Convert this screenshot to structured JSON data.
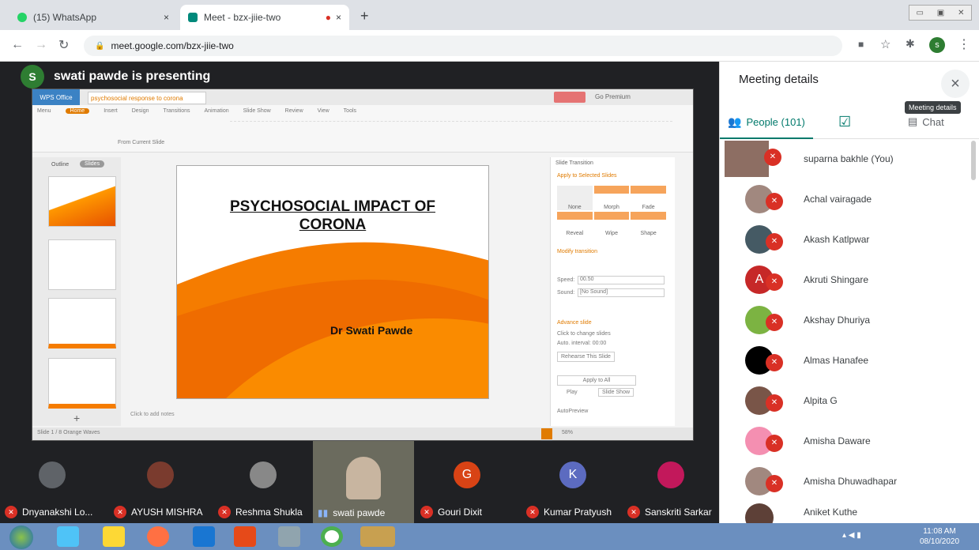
{
  "browser": {
    "tabs": [
      {
        "label": "(15) WhatsApp",
        "close": "×"
      },
      {
        "label": "Meet - bzx-jiie-two",
        "close": "×"
      }
    ],
    "new_tab": "+",
    "url": "meet.google.com/bzx-jiie-two",
    "profile_initial": "s"
  },
  "meet": {
    "presenter_initial": "S",
    "presenting_text": "swati pawde is presenting"
  },
  "slide": {
    "title_line1": "PSYCHOSOCIAL IMPACT OF",
    "title_line2": "CORONA",
    "author": "Dr Swati Pawde"
  },
  "app": {
    "left_tab": "Outline",
    "right_tab": "Slides",
    "panel_title": "Slide Transition",
    "panel_sub": "Apply to Selected Slides",
    "transitions": [
      "None",
      "Morph",
      "Fade",
      "Reveal",
      "Wipe",
      "Shape"
    ],
    "modify": "Modify transition",
    "speed_label": "Speed:",
    "speed_value": "00.50",
    "sound_label": "Sound:",
    "sound_value": "[No Sound]",
    "advance": "Advance slide",
    "on_click": "Click to change slides",
    "auto": "Auto. interval: 00:00",
    "rehearse": "Rehearse This Slide",
    "apply_all": "Apply to All",
    "play": "Play",
    "slide_show": "Slide Show",
    "autopreview": "AutoPreview",
    "notes": "Click to add notes",
    "status": "Slide 1 / 8   Orange Waves",
    "zoom": "58%",
    "present_btn": "Go Premium",
    "wps": "WPS Office",
    "doc_tab": "psychosocial response to corona",
    "from_current": "From Current Slide",
    "ribbon_tabs": [
      "Menu",
      "Home",
      "Insert",
      "Design",
      "Transitions",
      "Animation",
      "Slide Show",
      "Review",
      "View",
      "Tools"
    ]
  },
  "tiles": [
    {
      "name": "Dnyanakshi Lo...",
      "muted": true,
      "color": "#5f6368"
    },
    {
      "name": "AYUSH MISHRA",
      "muted": true,
      "color": "#7a3b2e"
    },
    {
      "name": "Reshma Shukla",
      "muted": true,
      "color": "#888888"
    },
    {
      "name": "swati pawde",
      "muted": false,
      "color": "#6b6b5e"
    },
    {
      "name": "Gouri Dixit",
      "muted": true,
      "initial": "G",
      "color": "#d84315"
    },
    {
      "name": "Kumar Pratyush",
      "muted": true,
      "initial": "K",
      "color": "#5c6bc0"
    },
    {
      "name": "Sanskriti Sarkar",
      "muted": true,
      "color": "#c2185b"
    }
  ],
  "panel": {
    "title": "Meeting details",
    "close": "×",
    "tooltip": "Meeting details",
    "people_tab": "People (101)",
    "chat_tab": "Chat",
    "people": [
      {
        "name": "suparna bakhle (You)",
        "color": "#8d6e63"
      },
      {
        "name": "Achal vairagade",
        "color": "#a1887f"
      },
      {
        "name": "Akash Katlpwar",
        "color": "#455a64"
      },
      {
        "name": "Akruti Shingare",
        "initial": "A",
        "color": "#c62828"
      },
      {
        "name": "Akshay Dhuriya",
        "color": "#7cb342"
      },
      {
        "name": "Almas Hanafee",
        "color": "#000000"
      },
      {
        "name": "Alpita G",
        "color": "#795548"
      },
      {
        "name": "Amisha Daware",
        "color": "#f48fb1"
      },
      {
        "name": "Amisha Dhuwadhapar",
        "color": "#a1887f"
      },
      {
        "name": "Aniket Kuthe",
        "color": "#5d4037"
      }
    ]
  },
  "taskbar": {
    "time": "11:08 AM",
    "date": "08/10/2020"
  },
  "colors": {
    "meet_dark": "#202124",
    "mute_red": "#d93025",
    "slide_orange": "#f57c00",
    "taskbar": "#6b8fbf"
  }
}
